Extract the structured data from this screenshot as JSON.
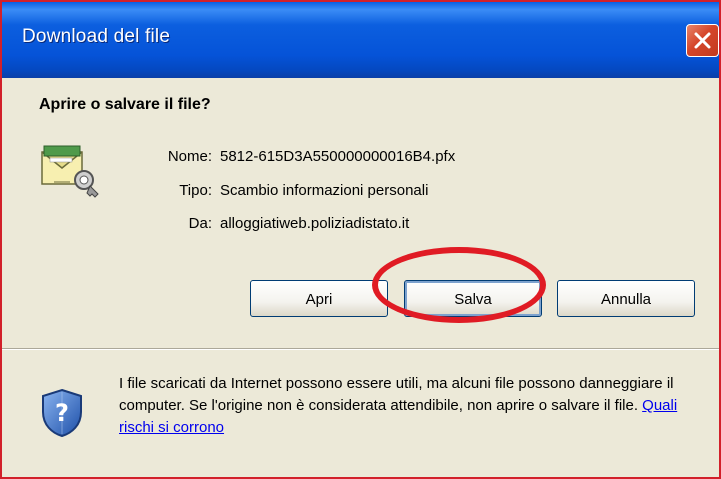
{
  "window": {
    "title": "Download del file"
  },
  "dialog": {
    "question": "Aprire o salvare il file?",
    "info": [
      {
        "label": "Nome:",
        "value": "5812-615D3A550000000016B4.pfx"
      },
      {
        "label": "Tipo:",
        "value": "Scambio informazioni personali"
      },
      {
        "label": "Da:",
        "value": "alloggiatiweb.poliziadistato.it"
      }
    ],
    "buttons": {
      "open": "Apri",
      "save": "Salva",
      "cancel": "Annulla"
    },
    "warning": {
      "text": "I file scaricati da Internet possono essere utili, ma alcuni file possono danneggiare il computer. Se l'origine non è considerata attendibile, non aprire o salvare il file. ",
      "link": "Quali rischi si corrono"
    }
  },
  "icons": {
    "file": "certificate-file-icon",
    "shield": "security-shield-icon",
    "close": "close-icon"
  },
  "colors": {
    "titlebar": "#0553d8",
    "dialog_bg": "#ece9d8",
    "highlight": "#e01b24",
    "close_button": "#d5462a"
  }
}
